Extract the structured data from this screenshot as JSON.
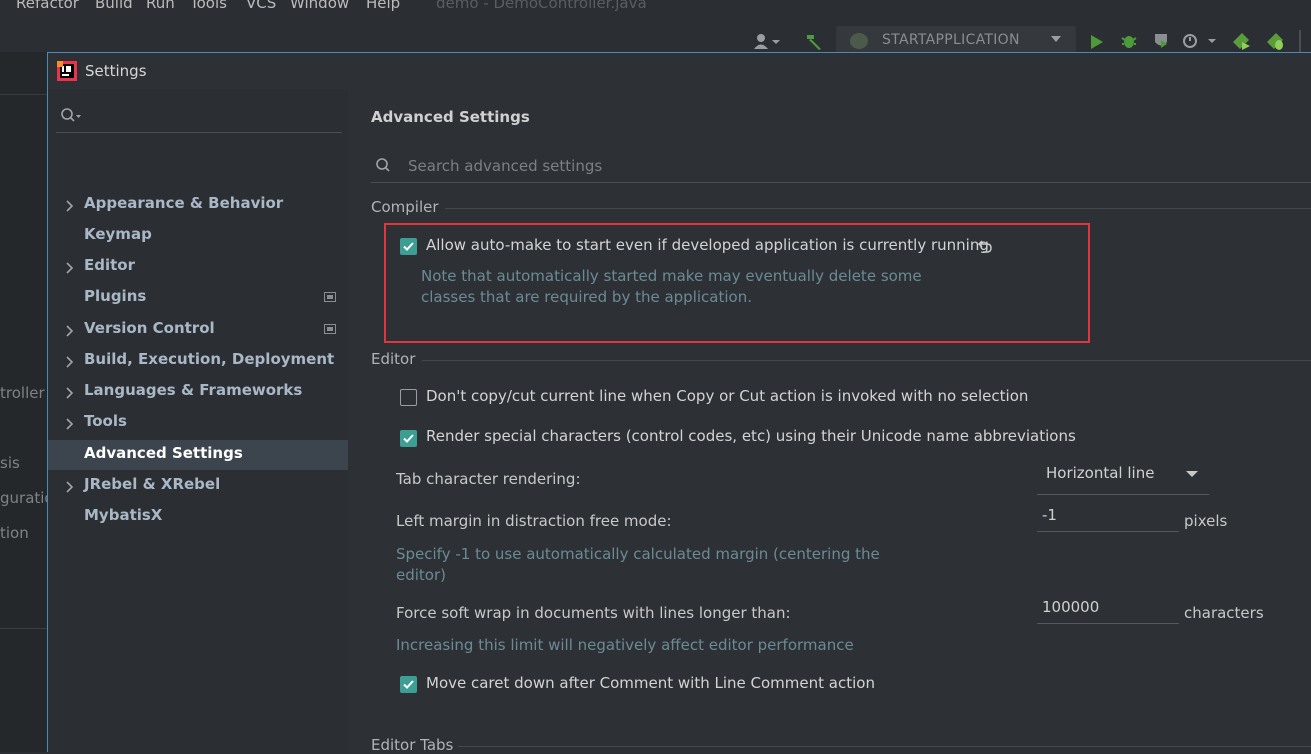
{
  "ide": {
    "menu": [
      "Refactor",
      "Build",
      "Run",
      "Tools",
      "VCS",
      "Window",
      "Help"
    ],
    "window_title": "demo - DemoController.java",
    "run_config": "STARTAPPLICATION",
    "left_fragments": [
      "troller",
      "sis",
      "guratio",
      "tion"
    ]
  },
  "dialog": {
    "title": "Settings"
  },
  "sidebar": {
    "items": [
      {
        "label": "Appearance & Behavior",
        "arrow": true,
        "badge": false
      },
      {
        "label": "Keymap",
        "arrow": false,
        "badge": false
      },
      {
        "label": "Editor",
        "arrow": true,
        "badge": false
      },
      {
        "label": "Plugins",
        "arrow": false,
        "badge": true
      },
      {
        "label": "Version Control",
        "arrow": true,
        "badge": true
      },
      {
        "label": "Build, Execution, Deployment",
        "arrow": true,
        "badge": false
      },
      {
        "label": "Languages & Frameworks",
        "arrow": true,
        "badge": false
      },
      {
        "label": "Tools",
        "arrow": true,
        "badge": false
      },
      {
        "label": "Advanced Settings",
        "arrow": false,
        "badge": false,
        "selected": true
      },
      {
        "label": "JRebel & XRebel",
        "arrow": true,
        "badge": false
      },
      {
        "label": "MybatisX",
        "arrow": false,
        "badge": false
      }
    ]
  },
  "content": {
    "title": "Advanced Settings",
    "search_placeholder": "Search advanced settings",
    "compiler": {
      "header": "Compiler",
      "auto_make": {
        "label": "Allow auto-make to start even if developed application is currently running",
        "checked": true,
        "note_line1": "Note that automatically started make may eventually delete some",
        "note_line2": "classes that are required by the application."
      }
    },
    "editor": {
      "header": "Editor",
      "dont_copy": {
        "label": "Don't copy/cut current line when Copy or Cut action is invoked with no selection",
        "checked": false
      },
      "render_special": {
        "label": "Render special characters (control codes, etc) using their Unicode name abbreviations",
        "checked": true
      },
      "tab_rendering": {
        "label": "Tab character rendering:",
        "value": "Horizontal line"
      },
      "left_margin": {
        "label": "Left margin in distraction free mode:",
        "value": "-1",
        "unit": "pixels",
        "note_line1": "Specify -1 to use automatically calculated margin (centering the",
        "note_line2": "editor)"
      },
      "soft_wrap": {
        "label": "Force soft wrap in documents with lines longer than:",
        "value": "100000",
        "unit": "characters",
        "note": "Increasing this limit will negatively affect editor performance"
      },
      "move_caret": {
        "label": "Move caret down after Comment with Line Comment action",
        "checked": true
      }
    },
    "editor_tabs": {
      "header": "Editor Tabs"
    }
  },
  "colors": {
    "accent_checkbox": "#3c9e94",
    "highlight_border": "#e0373e",
    "selected_row": "#3c454d"
  }
}
